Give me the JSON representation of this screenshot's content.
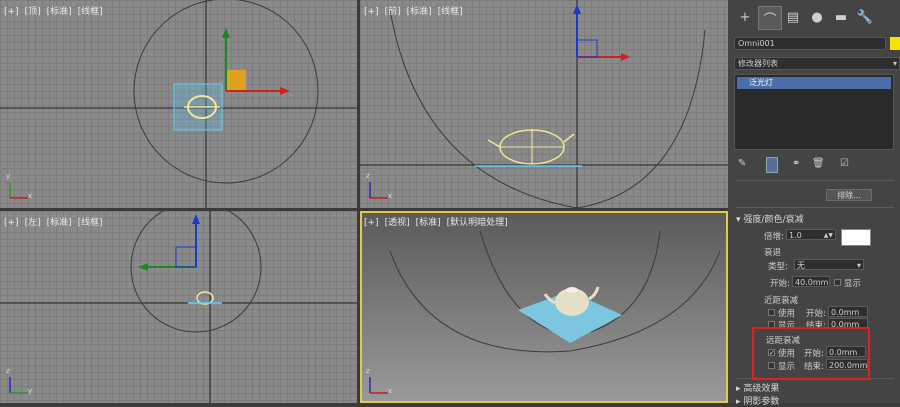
{
  "viewports": {
    "top": {
      "labels": [
        "[+]",
        "[顶]",
        "[标准]",
        "[线框]"
      ]
    },
    "front": {
      "labels": [
        "[+]",
        "[前]",
        "[标准]",
        "[线框]"
      ]
    },
    "left": {
      "labels": [
        "[+]",
        "[左]",
        "[标准]",
        "[线框]"
      ]
    },
    "persp": {
      "labels": [
        "[+]",
        "[透视]",
        "[标准]",
        "[默认明暗处理]"
      ]
    }
  },
  "axis_labels": {
    "x": "x",
    "y": "y",
    "z": "z"
  },
  "panel": {
    "tabs": [
      {
        "icon": "plus-icon",
        "glyph": "+"
      },
      {
        "icon": "modify-icon",
        "glyph": "⌒"
      },
      {
        "icon": "hierarchy-icon",
        "glyph": "▤"
      },
      {
        "icon": "motion-icon",
        "glyph": "●"
      },
      {
        "icon": "display-icon",
        "glyph": "▬"
      },
      {
        "icon": "utilities-icon",
        "glyph": "🔧"
      }
    ],
    "object_name": "Omni001",
    "object_color": "#f5e400",
    "modifier_list_label": "修改器列表",
    "modifier_selected": "泛光灯",
    "exclude_button": "排除...",
    "section_title": "强度/颜色/衰减",
    "multiplier_label": "倍增:",
    "multiplier_value": "1.0",
    "decay_label": "衰退",
    "type_label": "类型:",
    "type_value": "无",
    "decay_start_label": "开始:",
    "decay_start_value": "40.0mm",
    "show_label": "显示",
    "near_title": "近距衰减",
    "near_use": "使用",
    "near_show": "显示",
    "near_start_label": "开始:",
    "near_start_value": "0.0mm",
    "near_end_label": "结束:",
    "near_end_value": "0.0mm",
    "far_title": "远距衰减",
    "far_use": "使用",
    "far_show": "显示",
    "far_start_label": "开始:",
    "far_start_value": "0.0mm",
    "far_end_label": "结束:",
    "far_end_value": "200.0mm",
    "advanced_title": "高级效果",
    "shadow_title": "阴影参数",
    "collapse_glyph": "▾",
    "expand_glyph": "▸"
  }
}
